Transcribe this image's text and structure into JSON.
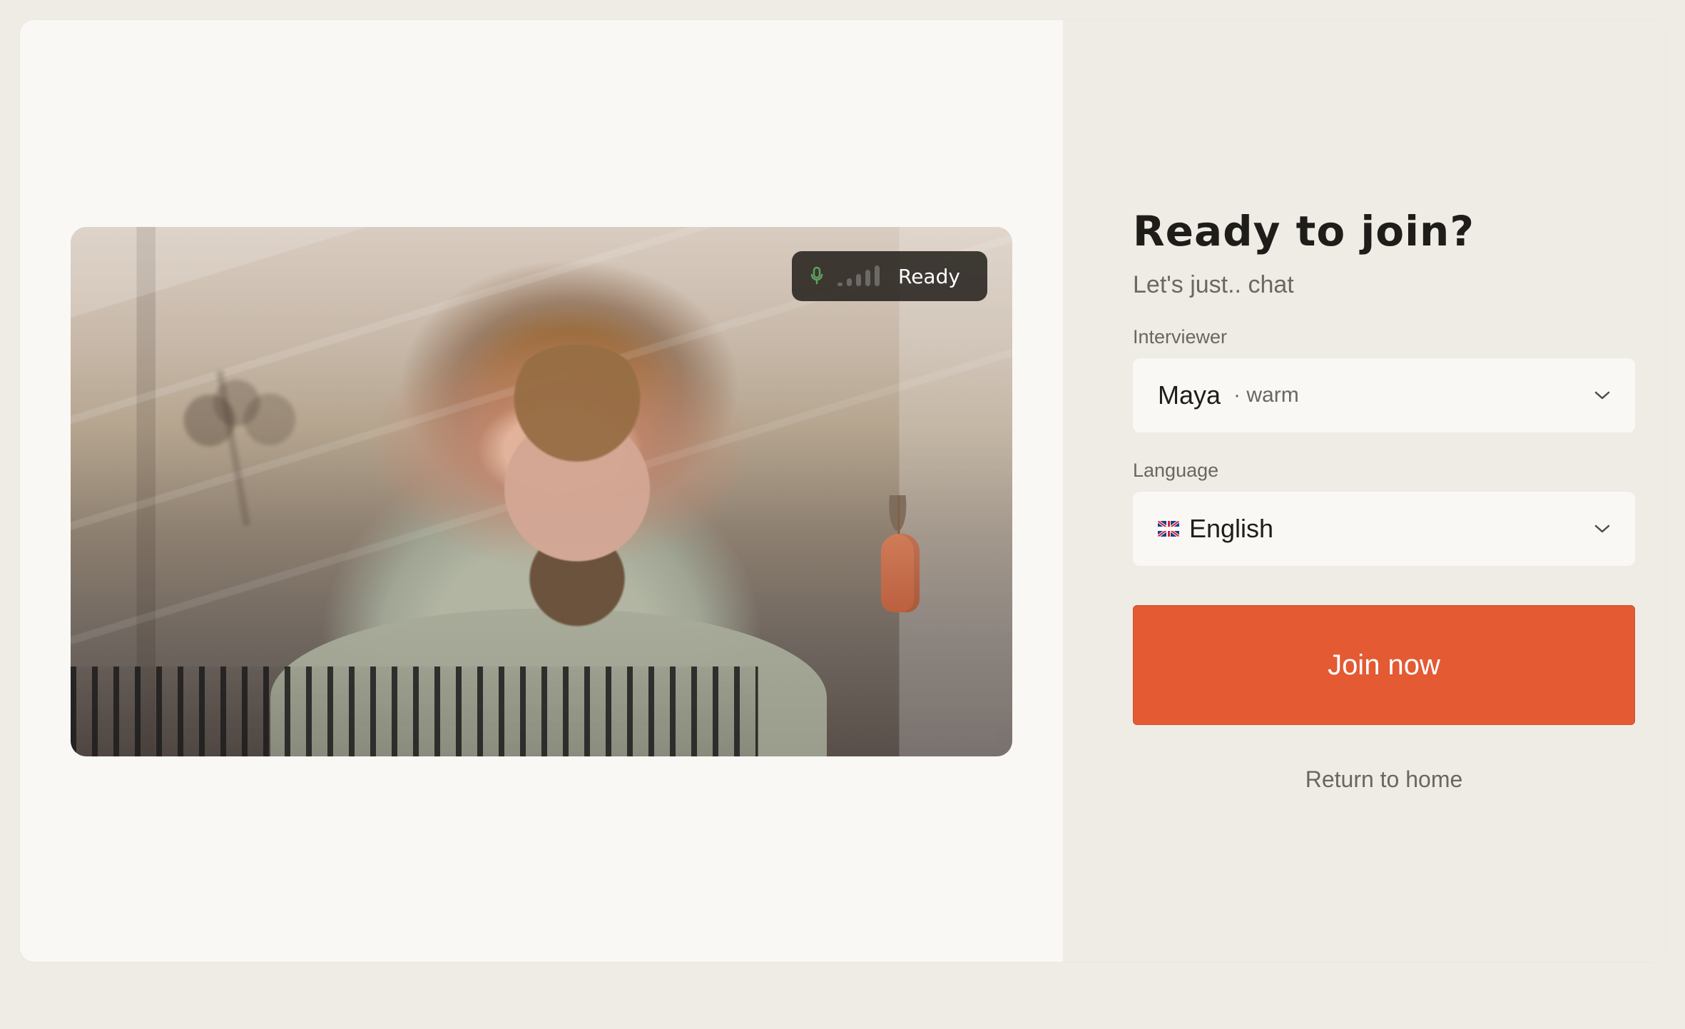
{
  "video": {
    "status_text": "Ready",
    "icons": {
      "status_mic": "microphone-icon",
      "mic": "microphone-icon",
      "camera": "video-camera-icon"
    },
    "status_levels": [
      0.2,
      0.35,
      0.55,
      0.75,
      0.95
    ]
  },
  "join": {
    "title": "Ready to join?",
    "subtitle": "Let's just.. chat",
    "interviewer_label": "Interviewer",
    "interviewer_name": "Maya",
    "interviewer_tone": "· warm",
    "language_label": "Language",
    "language_value": "English",
    "join_button": "Join now",
    "return_link": "Return to home"
  },
  "colors": {
    "page_bg": "#efebe5",
    "panel_bg": "#f9f8f5",
    "join_accent": "#e35a33",
    "text_primary": "#1f1d1a",
    "text_secondary": "#6a6661",
    "status_bg": "#231f1b",
    "status_green": "#5ea15f"
  }
}
